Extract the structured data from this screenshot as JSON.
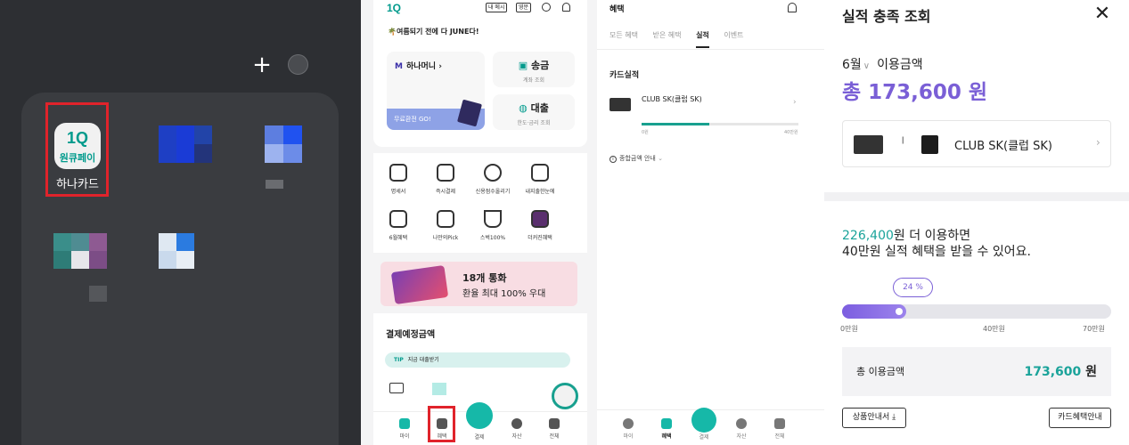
{
  "colors": {
    "highlight_red": "#e0232b",
    "hana_teal": "#009a8c",
    "accent_purple": "#7a5fd6",
    "accent_teal": "#1aa39a",
    "dark_bg": "#2d2f33"
  },
  "home_screen": {
    "plus_glyph": "+",
    "app_icon_logo": "1Q",
    "app_icon_sub": "원큐페이",
    "app_label": "하나카드"
  },
  "hana_app": {
    "logo": "1Q",
    "top_buttons": [
      "내 메시",
      "영문"
    ],
    "slogan": "🌴여름되기 전에 다 JUNE다!",
    "hana_money": {
      "title": "하나머니",
      "band": "무료환전 GO!"
    },
    "transfer": {
      "title": "송금",
      "sub": "계좌 조회"
    },
    "loan": {
      "title": "대출",
      "sub": "한도·금리 조회"
    },
    "shortcuts": [
      "명세서",
      "즉시결제",
      "신용점수올리기",
      "내지출한눈에",
      "6월혜택",
      "나만의Pick",
      "스벅100%",
      "더커진혜택"
    ],
    "banner": {
      "title": "18개 통화",
      "sub": "환율 최대 100% 우대"
    },
    "payment_section": {
      "title": "결제예정금액",
      "tip_tag": "TIP",
      "tip_text": "지금 대출받기"
    },
    "tabs": [
      "마이",
      "혜택",
      "결제",
      "자산",
      "전체"
    ]
  },
  "benefits_screen": {
    "header": "혜택",
    "tabs": [
      "모든 혜택",
      "받은 혜택",
      "실적",
      "이벤트"
    ],
    "active_tab": "실적",
    "section_title": "카드실적",
    "card_name": "CLUB SK(클럽 SK)",
    "bar_start": "0원",
    "bar_end": "40만원",
    "bar_fraction": 0.43,
    "info_text": "종합금액 안내",
    "tabs_bottom": [
      "마이",
      "혜택",
      "결제",
      "자산",
      "전체"
    ]
  },
  "performance_screen": {
    "title": "실적 충족 조회",
    "month": "6월",
    "usage_label": "이용금액",
    "total": "총 173,600 원",
    "card_name": "CLUB SK(클럽 SK)",
    "remaining_amount": "226,400",
    "message_line1_rest": "원 더 이용하면",
    "message_line2": "40만원 실적 혜택을 받을 수 있어요.",
    "percent_label": "24 %",
    "progress_fraction": 0.24,
    "ticks": [
      "0만원",
      "40만원",
      "70만원"
    ],
    "sum_label": "총 이용금액",
    "sum_value": "173,600",
    "sum_unit": "원",
    "btn_product": "상품안내서 ⤓",
    "btn_benefit": "카드혜택안내"
  }
}
